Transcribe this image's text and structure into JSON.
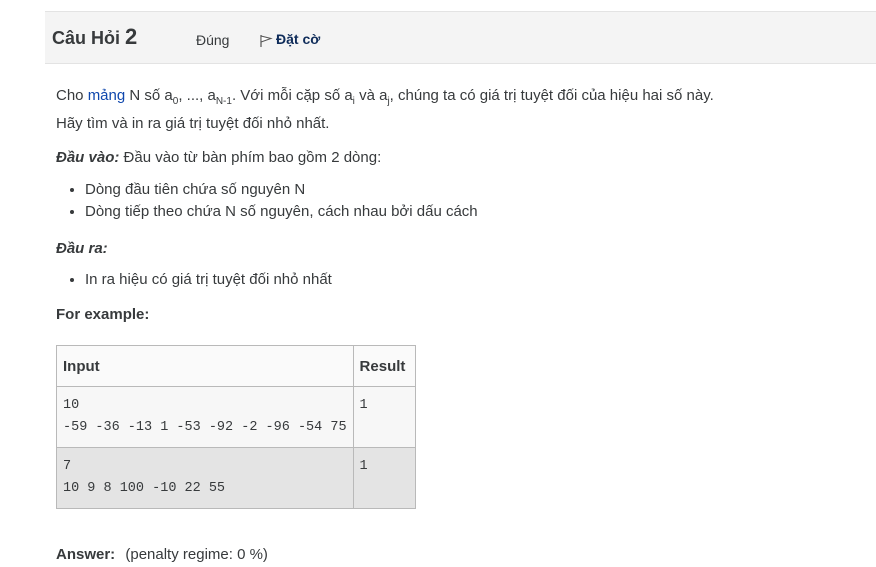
{
  "question": {
    "title_prefix": "Câu Hỏi",
    "number": "2",
    "state": "Đúng",
    "flag_label": "Đặt cờ"
  },
  "text": {
    "p1_start": "Cho ",
    "p1_link": "mảng",
    "p1_mid": " N số a",
    "sub0": "0",
    "p1_mid2": ", ..., a",
    "subN": "N-1",
    "p1_mid3": ". Với mỗi cặp số a",
    "subi": "i",
    "p1_mid4": " và a",
    "subj": "j",
    "p1_end": ", chúng ta có giá trị tuyệt đối của hiệu hai số này.",
    "p2": "Hãy tìm và in ra giá trị tuyệt đối nhỏ nhất.",
    "input_label": "Đầu vào:",
    "input_desc": " Đầu vào từ bàn phím bao gồm 2 dòng:",
    "input_items": [
      "Dòng đầu tiên chứa số nguyên N",
      "Dòng tiếp theo chứa N số nguyên, cách nhau bởi dấu cách"
    ],
    "output_label": "Đầu ra:",
    "output_items": [
      "In ra  hiệu có giá trị tuyệt đối nhỏ nhất"
    ],
    "example_label": "For example:"
  },
  "example_table": {
    "headers": [
      "Input",
      "Result"
    ],
    "rows": [
      {
        "input": "10\n-59 -36 -13 1 -53 -92 -2 -96 -54 75",
        "result": "1"
      },
      {
        "input": "7\n10 9 8 100 -10 22 55",
        "result": "1"
      }
    ]
  },
  "answer": {
    "label": "Answer:",
    "penalty": "(penalty regime: 0 %)"
  },
  "colors": {
    "header_bg": "#f4f4f4",
    "link": "#0f47ad",
    "flag": "#0f2c5a"
  }
}
